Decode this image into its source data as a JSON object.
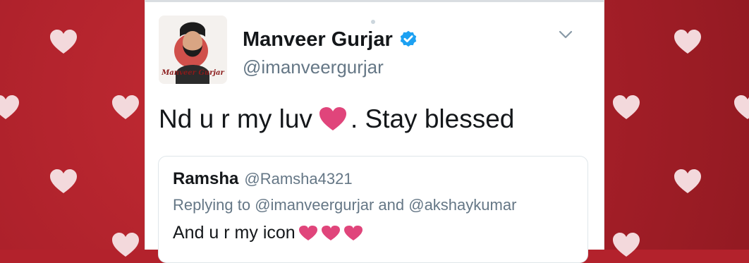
{
  "tweet": {
    "display_name": "Manveer Gurjar",
    "handle": "@imanveergurjar",
    "avatar_caption": "Manveer Gurjar",
    "text_before_heart": "Nd u r my luv",
    "text_after_heart": ". Stay blessed",
    "verified_icon": "verified-badge-icon",
    "menu_icon": "chevron-down-icon"
  },
  "quoted_tweet": {
    "display_name": "Ramsha",
    "handle": "@Ramsha4321",
    "replying_prefix": "Replying to",
    "replying_user1": "@imanveergurjar",
    "replying_and": "and",
    "replying_user2": "@akshaykumar",
    "text": "And u r my icon"
  },
  "colors": {
    "background": "#b3222c",
    "heart_pink": "#e0457b",
    "verified_blue": "#1da1f2",
    "secondary_text": "#657786",
    "primary_text": "#14171a"
  }
}
